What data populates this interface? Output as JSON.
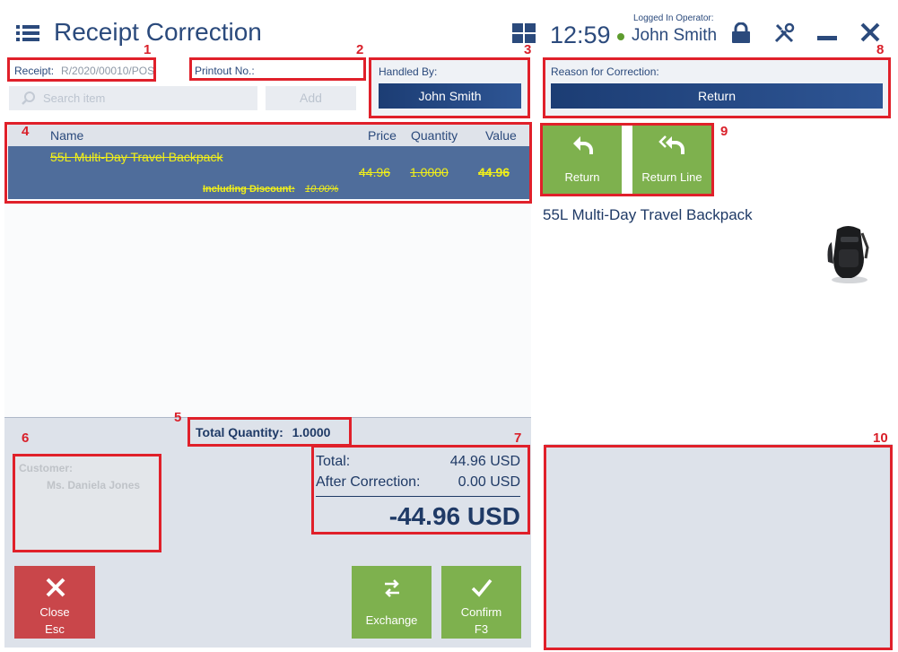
{
  "header": {
    "title": "Receipt Correction",
    "clock": "12:59",
    "operator_label": "Logged In Operator:",
    "operator_name": "John Smith",
    "icons": [
      "menu-icon",
      "grid-icon",
      "lock-icon",
      "tools-icon",
      "minimize-icon",
      "close-icon"
    ]
  },
  "fields": {
    "receipt_label": "Receipt:",
    "receipt_value": "R/2020/00010/POS",
    "printout_label": "Printout No.:",
    "search_placeholder": "Search item",
    "add_label": "Add",
    "handled_by_label": "Handled By:",
    "handled_by_value": "John Smith",
    "reason_label": "Reason for Correction:",
    "reason_value": "Return"
  },
  "table": {
    "columns": [
      "Name",
      "Price",
      "Quantity",
      "Value"
    ],
    "rows": [
      {
        "name": "55L Multi-Day Travel Backpack",
        "price": "44.96",
        "quantity": "1.0000",
        "value": "44.96",
        "discount_label": "Including Discount:",
        "discount_value": "10.00%"
      }
    ]
  },
  "total_quantity_label": "Total Quantity:",
  "total_quantity_value": "1.0000",
  "customer": {
    "label": "Customer:",
    "name": "Ms. Daniela Jones"
  },
  "totals": {
    "total_label": "Total:",
    "total_value": "44.96 USD",
    "after_label": "After Correction:",
    "after_value": "0.00 USD",
    "diff": "-44.96 USD"
  },
  "buttons": {
    "close_label": "Close",
    "close_key": "Esc",
    "exchange_label": "Exchange",
    "confirm_label": "Confirm",
    "confirm_key": "F3",
    "return_label": "Return",
    "return_line_label": "Return Line"
  },
  "item_preview": {
    "name": "55L Multi-Day Travel Backpack"
  },
  "annotations": [
    "1",
    "2",
    "3",
    "4",
    "5",
    "6",
    "7",
    "8",
    "9",
    "10"
  ],
  "colors": {
    "accent_blue": "#1f3a66",
    "highlight_red": "#e0202a",
    "green": "#7eb14e",
    "close_red": "#c9464a",
    "selected_row": "#4f6d9b",
    "yellow_text": "#f1ef19"
  }
}
